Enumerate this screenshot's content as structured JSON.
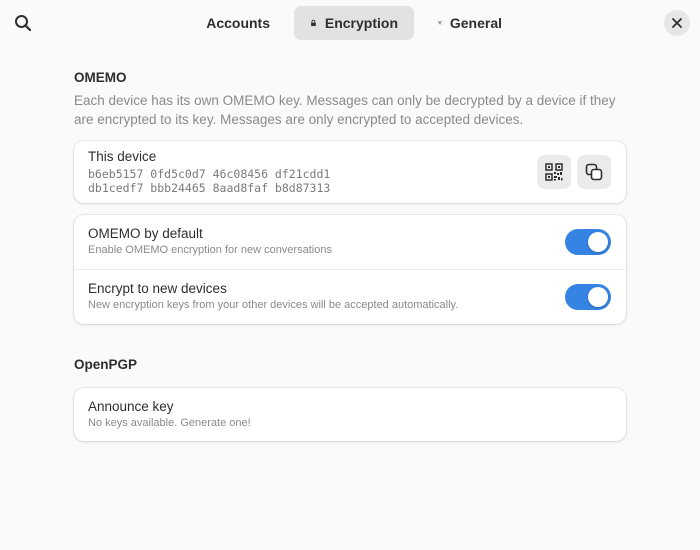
{
  "header": {
    "tabs": [
      {
        "label": "Accounts",
        "icon": "people-icon",
        "active": false
      },
      {
        "label": "Encryption",
        "icon": "lock-icon",
        "active": true
      },
      {
        "label": "General",
        "icon": "tools-icon",
        "active": false
      }
    ]
  },
  "omemo": {
    "title": "OMEMO",
    "description": "Each device has its own OMEMO key. Messages can only be decrypted by a device if they are encrypted to its key. Messages are only encrypted to accepted devices.",
    "this_device": {
      "title": "This device",
      "fingerprint_line1": "b6eb5157 0fd5c0d7 46c08456 df21cdd1",
      "fingerprint_line2": "db1cedf7 bbb24465 8aad8faf b8d87313"
    },
    "settings": [
      {
        "title": "OMEMO by default",
        "subtitle": "Enable OMEMO encryption for new conversations",
        "enabled": true
      },
      {
        "title": "Encrypt to new devices",
        "subtitle": "New encryption keys from your other devices will be accepted automatically.",
        "enabled": true
      }
    ]
  },
  "openpgp": {
    "title": "OpenPGP",
    "announce_key": {
      "title": "Announce key",
      "subtitle": "No keys available. Generate one!"
    }
  },
  "colors": {
    "accent": "#3584e4",
    "background": "#fafafa",
    "card": "#ffffff"
  }
}
